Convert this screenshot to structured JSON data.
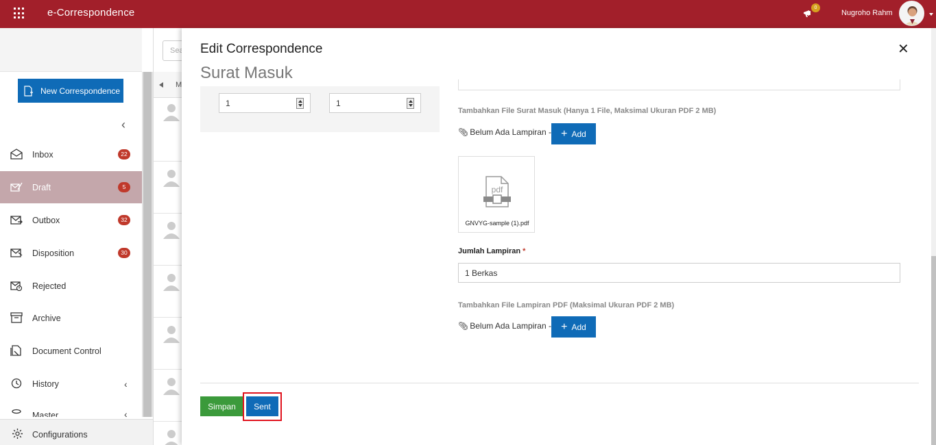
{
  "app": {
    "title": "e-Correspondence"
  },
  "header": {
    "notification_count": "0",
    "user_name": "Nugroho Rahm"
  },
  "sidebar": {
    "new_button": "New Correspondence",
    "items": [
      {
        "label": "Inbox",
        "badge": "22",
        "icon": "inbox-icon"
      },
      {
        "label": "Draft",
        "badge": "5",
        "icon": "draft-icon",
        "active": true
      },
      {
        "label": "Outbox",
        "badge": "32",
        "icon": "outbox-icon"
      },
      {
        "label": "Disposition",
        "badge": "30",
        "icon": "disposition-icon"
      },
      {
        "label": "Rejected",
        "badge": "",
        "icon": "rejected-icon"
      },
      {
        "label": "Archive",
        "badge": "",
        "icon": "archive-icon"
      },
      {
        "label": "Document Control",
        "badge": "",
        "icon": "document-control-icon"
      },
      {
        "label": "History",
        "badge": "",
        "icon": "history-icon"
      },
      {
        "label": "Master",
        "badge": "",
        "icon": "master-icon"
      }
    ],
    "configurations": "Configurations"
  },
  "list": {
    "search_placeholder": "Sea",
    "header_col": "M"
  },
  "panel": {
    "title": "Edit Correspondence",
    "subtitle": "Surat Masuk",
    "number_inputs": [
      "1",
      "1"
    ],
    "file_section_label": "Tambahkan File Surat Masuk (Hanya 1 File, Maksimal Ukuran PDF 2 MB)",
    "no_attachment_text": "Belum Ada Lampiran -",
    "add_label": "Add",
    "pdf_file_name": "GNVYG-sample (1).pdf",
    "pdf_icon_text": "pdf",
    "jumlah_label": "Jumlah Lampiran",
    "jumlah_required": "*",
    "jumlah_value": "1 Berkas",
    "lampiran_section_label": "Tambahkan File Lampiran PDF (Maksimal Ukuran PDF 2 MB)",
    "no_attachment_text_2": "Belum Ada Lampiran -",
    "add_label_2": "Add",
    "simpan_label": "Simpan",
    "sent_label": "Sent"
  },
  "colors": {
    "topbar": "#a21f2a",
    "primary": "#0f6bb7",
    "success": "#3b9a3b",
    "badge": "#c0392b",
    "highlight": "#e0121d"
  }
}
